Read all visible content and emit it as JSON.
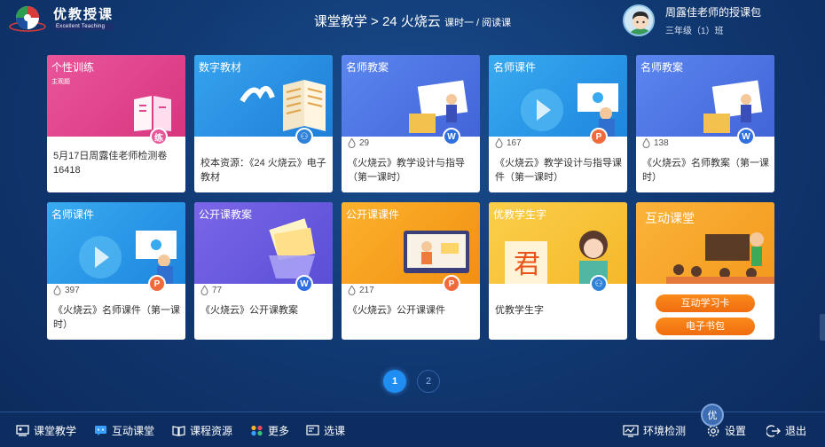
{
  "header": {
    "logo_cn": "优教授课",
    "logo_en": "Excellent Teaching",
    "title_main": "课堂教学 > 24 火烧云",
    "title_sub": "课时一 / 阅读课",
    "user_name": "周露佳老师的授课包",
    "user_class": "三年级（1）班"
  },
  "cards": [
    {
      "label": "个性训练",
      "sublabel": "主观题",
      "views": "",
      "title": "5月17日周露佳老师检测卷16418",
      "badge": "练",
      "badge_color": "#e8579a",
      "bg": "#e1448d"
    },
    {
      "label": "数字教材",
      "views": "",
      "title": "校本资源：《24 火烧云》电子教材",
      "badge": "⚇",
      "badge_color": "#2f82d8",
      "bg": "#2a8de0"
    },
    {
      "label": "名师教案",
      "views": "29",
      "title": "《火烧云》教学设计与指导（第一课时）",
      "badge": "W",
      "badge_color": "#2f6fe0",
      "bg": "#4f79e8"
    },
    {
      "label": "名师课件",
      "views": "167",
      "title": "《火烧云》教学设计与指导课件（第一课时）",
      "badge": "P",
      "badge_color": "#f06a3c",
      "bg": "#2b9be8"
    },
    {
      "label": "名师教案",
      "views": "138",
      "title": "《火烧云》名师教案（第一课时）",
      "badge": "W",
      "badge_color": "#2f6fe0",
      "bg": "#4f79e8"
    },
    {
      "label": "名师课件",
      "views": "397",
      "title": "《火烧云》名师课件（第一课时）",
      "badge": "P",
      "badge_color": "#f06a3c",
      "bg": "#2b9be8"
    },
    {
      "label": "公开课教案",
      "views": "77",
      "title": "《火烧云》公开课教案",
      "badge": "W",
      "badge_color": "#2f6fe0",
      "bg": "#6a5ce0"
    },
    {
      "label": "公开课课件",
      "views": "217",
      "title": "《火烧云》公开课课件",
      "badge": "P",
      "badge_color": "#f06a3c",
      "bg": "#f6a21d"
    },
    {
      "label": "优教学生字",
      "views": "",
      "title": "优教学生字",
      "badge": "⚇",
      "badge_color": "#2f82d8",
      "bg": "#f8c640"
    },
    {
      "label": "互动课堂",
      "views": "",
      "title": "",
      "btn1": "互动学习卡",
      "btn2": "电子书包",
      "bg": "#f6a41e"
    }
  ],
  "pagination": {
    "pages": [
      "1",
      "2"
    ],
    "current": "1"
  },
  "bottom_nav": {
    "items": [
      {
        "label": "课堂教学",
        "icon": "classroom-icon"
      },
      {
        "label": "互动课堂",
        "icon": "interactive-icon"
      },
      {
        "label": "课程资源",
        "icon": "book-icon"
      },
      {
        "label": "更多",
        "icon": "more-grid-icon"
      },
      {
        "label": "选课",
        "icon": "select-course-icon"
      }
    ],
    "right_items": [
      {
        "label": "环境检测",
        "icon": "monitor-icon"
      },
      {
        "label": "设置",
        "icon": "gear-icon"
      },
      {
        "label": "退出",
        "icon": "exit-icon"
      }
    ],
    "fab_label": "优"
  }
}
